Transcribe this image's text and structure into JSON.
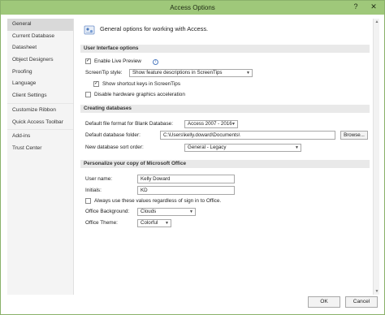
{
  "window": {
    "title": "Access Options",
    "help_glyph": "?",
    "close_glyph": "✕"
  },
  "sidebar": {
    "items": [
      {
        "label": "General",
        "active": true
      },
      {
        "label": "Current Database"
      },
      {
        "label": "Datasheet"
      },
      {
        "label": "Object Designers"
      },
      {
        "label": "Proofing"
      },
      {
        "label": "Language"
      },
      {
        "label": "Client Settings"
      },
      {
        "label": "Customize Ribbon"
      },
      {
        "label": "Quick Access Toolbar"
      },
      {
        "label": "Add-ins"
      },
      {
        "label": "Trust Center"
      }
    ]
  },
  "general": {
    "headline": "General options for working with Access.",
    "ui_section": {
      "title": "User Interface options",
      "live_preview": {
        "label": "Enable Live Preview",
        "checked": true
      },
      "screentip_label": "ScreenTip style:",
      "screentip_value": "Show feature descriptions in ScreenTips",
      "shortcut_keys": {
        "label": "Show shortcut keys in ScreenTips",
        "checked": true
      },
      "disable_hw": {
        "label": "Disable hardware graphics acceleration",
        "checked": false
      }
    },
    "db_section": {
      "title": "Creating databases",
      "default_format_label": "Default file format for Blank Database:",
      "default_format_value": "Access 2007 - 2016",
      "default_folder_label": "Default database folder:",
      "default_folder_value": "C:\\Users\\kelly.doward\\Documents\\",
      "browse_label": "Browse...",
      "sort_order_label": "New database sort order:",
      "sort_order_value": "General - Legacy"
    },
    "personalize_section": {
      "title": "Personalize your copy of Microsoft Office",
      "user_name_label": "User name:",
      "user_name_value": "Kelly Doward",
      "initials_label": "Initials:",
      "initials_value": "KD",
      "always_use": {
        "label": "Always use these values regardless of sign in to Office.",
        "checked": false
      },
      "background_label": "Office Background:",
      "background_value": "Clouds",
      "theme_label": "Office Theme:",
      "theme_value": "Colorful"
    }
  },
  "footer": {
    "ok_label": "OK",
    "cancel_label": "Cancel"
  },
  "colors": {
    "titlebar": "#9fc87a",
    "accent": "#4f7cc0"
  }
}
